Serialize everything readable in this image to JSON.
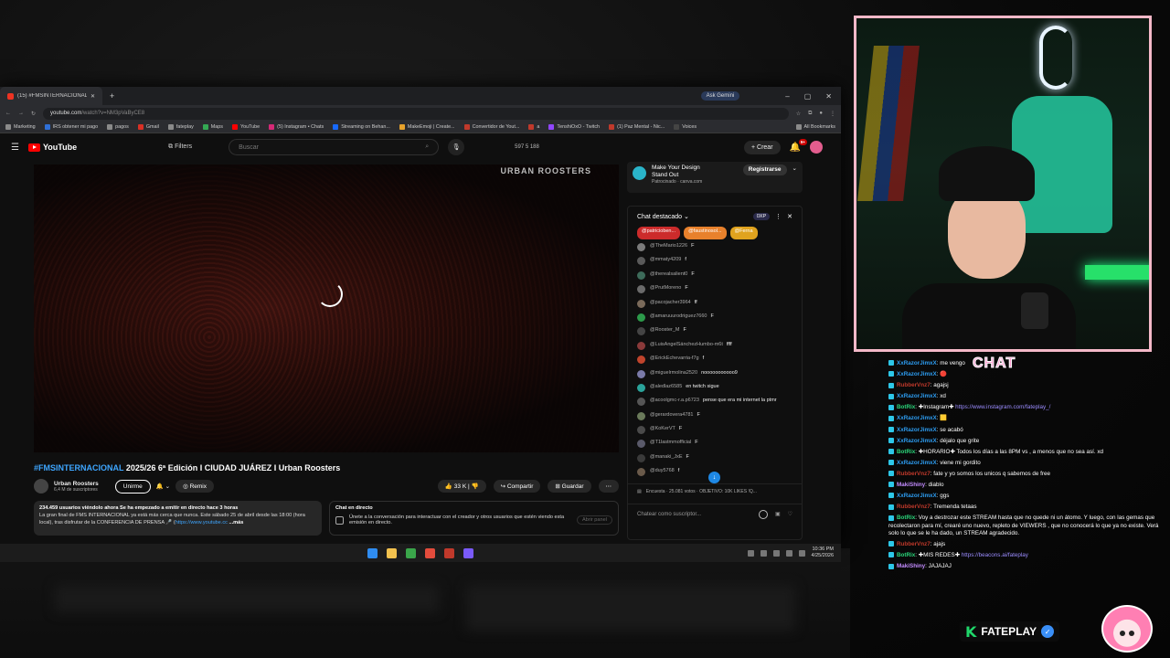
{
  "browser": {
    "tab_title": "(15) #FMSINTERNACIONAL 20",
    "ask_gemini": "Ask Gemini",
    "url_host": "youtube.com",
    "url_rest": "/watch?v=NM3pVaByCE8",
    "bookmarks": [
      {
        "label": "Marketing",
        "color": "#8a8a8a"
      },
      {
        "label": "IRS obtener mi pago",
        "color": "#2f6fd6"
      },
      {
        "label": "pagos",
        "color": "#8a8a8a"
      },
      {
        "label": "Gmail",
        "color": "#d93025"
      },
      {
        "label": "fateplay",
        "color": "#8a8a8a"
      },
      {
        "label": "Maps",
        "color": "#34a853"
      },
      {
        "label": "YouTube",
        "color": "#ff0000"
      },
      {
        "label": "(5) Instagram • Chats",
        "color": "#d62976"
      },
      {
        "label": "Streaming on Behan...",
        "color": "#1769ff"
      },
      {
        "label": "MakeEmoji | Create...",
        "color": "#e7a22b"
      },
      {
        "label": "Convertidor de Yout...",
        "color": "#c0392b"
      },
      {
        "label": "a",
        "color": "#c0392b"
      },
      {
        "label": "TenshiOxO - Twitch",
        "color": "#9146ff"
      },
      {
        "label": "(1) Paz Mental - Nic...",
        "color": "#c0392b"
      },
      {
        "label": "Voices",
        "color": "#444444"
      },
      {
        "label": "All Bookmarks",
        "color": "#8a8a8a"
      }
    ]
  },
  "youtube": {
    "logo": "YouTube",
    "filters": "Filters",
    "search_placeholder": "Buscar",
    "ext_counts": "597  5  188",
    "create": "Crear",
    "bell_count": "9+",
    "player_sign": "URBAN ROOSTERS",
    "title_tag": "#FMSINTERNACIONAL",
    "title_rest": " 2025/26 6ª Edición I CIUDAD JUÁREZ I Urban Roosters",
    "channel": "Urban Roosters",
    "subs": "6,4 M de suscriptores",
    "join": "Unirme",
    "remix": "Remix",
    "likes": "33 K",
    "share": "Compartir",
    "save": "Guardar",
    "desc_stats": "234.459 usuarios viéndolo ahora  Se ha empezado a emitir en directo hace 3 horas",
    "desc_body": "La gran final de FMS INTERNACIONAL ya está más cerca que nunca. Este sábado 25 de abril desde las 18:00 (hora local), tras disfrutar de la CONFERENCIA DE PRENSA 🎤 (",
    "desc_link": "https://www.youtube.cc",
    "desc_more": "...más",
    "chat_live_title": "Chat en directo",
    "chat_live_text": "Únete a la conversación para interactuar con el creador y otros usuarios que estén viendo esta emisión en directo.",
    "chat_live_btn": "Abrir panel"
  },
  "ad": {
    "title_1": "Make Your Design",
    "title_2": "Stand Out",
    "sponsor": "Patrocinado · canva.com",
    "cta": "Registrarse"
  },
  "ytchat": {
    "header": "Chat destacado",
    "points": "0XP",
    "pinned": [
      {
        "label": "@patricioben...",
        "color": "#cc2b2b"
      },
      {
        "label": "@faustinosol...",
        "color": "#e8812c"
      },
      {
        "label": "@Ferna",
        "color": "#e0a31e"
      }
    ],
    "messages": [
      {
        "user": "@TheMario1226",
        "text": "F",
        "color": "#7b7b7b"
      },
      {
        "user": "@mmaty4209",
        "text": "f",
        "color": "#5a5a5a"
      },
      {
        "user": "@therealsalient0",
        "text": "F",
        "color": "#3d6b5a"
      },
      {
        "user": "@PrutMoreno",
        "text": "F",
        "color": "#6b6b6b"
      },
      {
        "user": "@pacojacher3964",
        "text": "ff",
        "color": "#7a6a5a"
      },
      {
        "user": "@amaruuurodriguez7660",
        "text": "F",
        "color": "#2c9a4a"
      },
      {
        "user": "@Rooster_M",
        "text": "F",
        "color": "#444444"
      },
      {
        "user": "@LuisAngelSánchezHumbo-m6t",
        "text": "ffff",
        "color": "#8a3a3a"
      },
      {
        "user": "@ErickEchevarria-f7g",
        "text": "f",
        "color": "#c0442c"
      },
      {
        "user": "@miguelrmolina2520",
        "text": "nooooooooooo9",
        "color": "#7a7aa8"
      },
      {
        "user": "@aledlaz6585",
        "text": "en twitch sigue",
        "color": "#2aa39a"
      },
      {
        "user": "@acoolgmc-r.a.p6723",
        "text": "pense que era mi internet la ptmr",
        "color": "#555555"
      },
      {
        "user": "@gerardovera4781",
        "text": "F",
        "color": "#6a7a5a"
      },
      {
        "user": "@KoKerVT",
        "text": "F",
        "color": "#4a4a4a"
      },
      {
        "user": "@T1lastmmofficial",
        "text": "F",
        "color": "#5a5a6a"
      },
      {
        "user": "@manaki_JxE",
        "text": "F",
        "color": "#3a3a3a"
      },
      {
        "user": "@duy5768",
        "text": "f",
        "color": "#6a5a4a"
      }
    ],
    "poll": "Encuesta · 25.081 votos · OBJETIVO: 10K LIKES !Q...",
    "input_placeholder": "Chatear como suscriptor..."
  },
  "taskbar": {
    "apps": [
      "#2f8cf0",
      "#f2c14e",
      "#3aa54a",
      "#e34c3c",
      "#c0392b",
      "#7a5af8"
    ],
    "time": "10:36 PM",
    "date": "4/25/2026"
  },
  "overlay": {
    "chat_logo": "CHAT",
    "lines": [
      {
        "user": "XxRazorJimxX",
        "user_color": "#2d9cf0",
        "text": ": me vengo"
      },
      {
        "user": "XxRazorJimxX",
        "user_color": "#2d9cf0",
        "text": ": 🔴"
      },
      {
        "user": "RubberVnz7",
        "user_color": "#c0392b",
        "text": ": agajsj"
      },
      {
        "user": "XxRazorJimxX",
        "user_color": "#2d9cf0",
        "text": ": xd"
      },
      {
        "user": "BotRix",
        "user_color": "#2bd67b",
        "text": ": ✚Instagram✚ ",
        "link": "https://www.instagram.com/fateplay_/"
      },
      {
        "user": "XxRazorJimxX",
        "user_color": "#2d9cf0",
        "text": ": 🟨"
      },
      {
        "user": "XxRazorJimxX",
        "user_color": "#2d9cf0",
        "text": ": se acabó"
      },
      {
        "user": "XxRazorJimxX",
        "user_color": "#2d9cf0",
        "text": ": déjalo que grite"
      },
      {
        "user": "BotRix",
        "user_color": "#2bd67b",
        "text": ": ✚HORARIO✚ Todos los días a las 8PM vs , a menos que no sea así. xd"
      },
      {
        "user": "XxRazorJimxX",
        "user_color": "#2d9cf0",
        "text": ": viene mi gordito"
      },
      {
        "user": "RubberVnz7",
        "user_color": "#c0392b",
        "text": ": fate y yo somos los unicos q sabemos de free"
      },
      {
        "user": "MakiShiny",
        "user_color": "#c38cff",
        "text": ": diablo"
      },
      {
        "user": "XxRazorJimxX",
        "user_color": "#2d9cf0",
        "text": ": ggs"
      },
      {
        "user": "RubberVnz7",
        "user_color": "#c0392b",
        "text": ": Tremenda tetaas"
      },
      {
        "user": "BotRix",
        "user_color": "#2bd67b",
        "text": ": Voy a destrozar este STREAM hasta que no quede ni un átomo. Y luego, con las gemas que recolectaron para mí, crearé uno nuevo, repleto de VIEWERS , que no conocerá lo que ya no existe. Verá solo lo que se le ha dado, un STREAM agradecido."
      },
      {
        "user": "RubberVnz7",
        "user_color": "#c0392b",
        "text": ": ajajs"
      },
      {
        "user": "BotRix",
        "user_color": "#2bd67b",
        "text": ": ✚MIS REDES✚ ",
        "link": "https://beacons.ai/fateplay"
      },
      {
        "user": "MakiShiny",
        "user_color": "#c38cff",
        "text": ": JAJAJAJ"
      }
    ],
    "brand_name": "FATEPLAY",
    "brand_check": "✓"
  }
}
